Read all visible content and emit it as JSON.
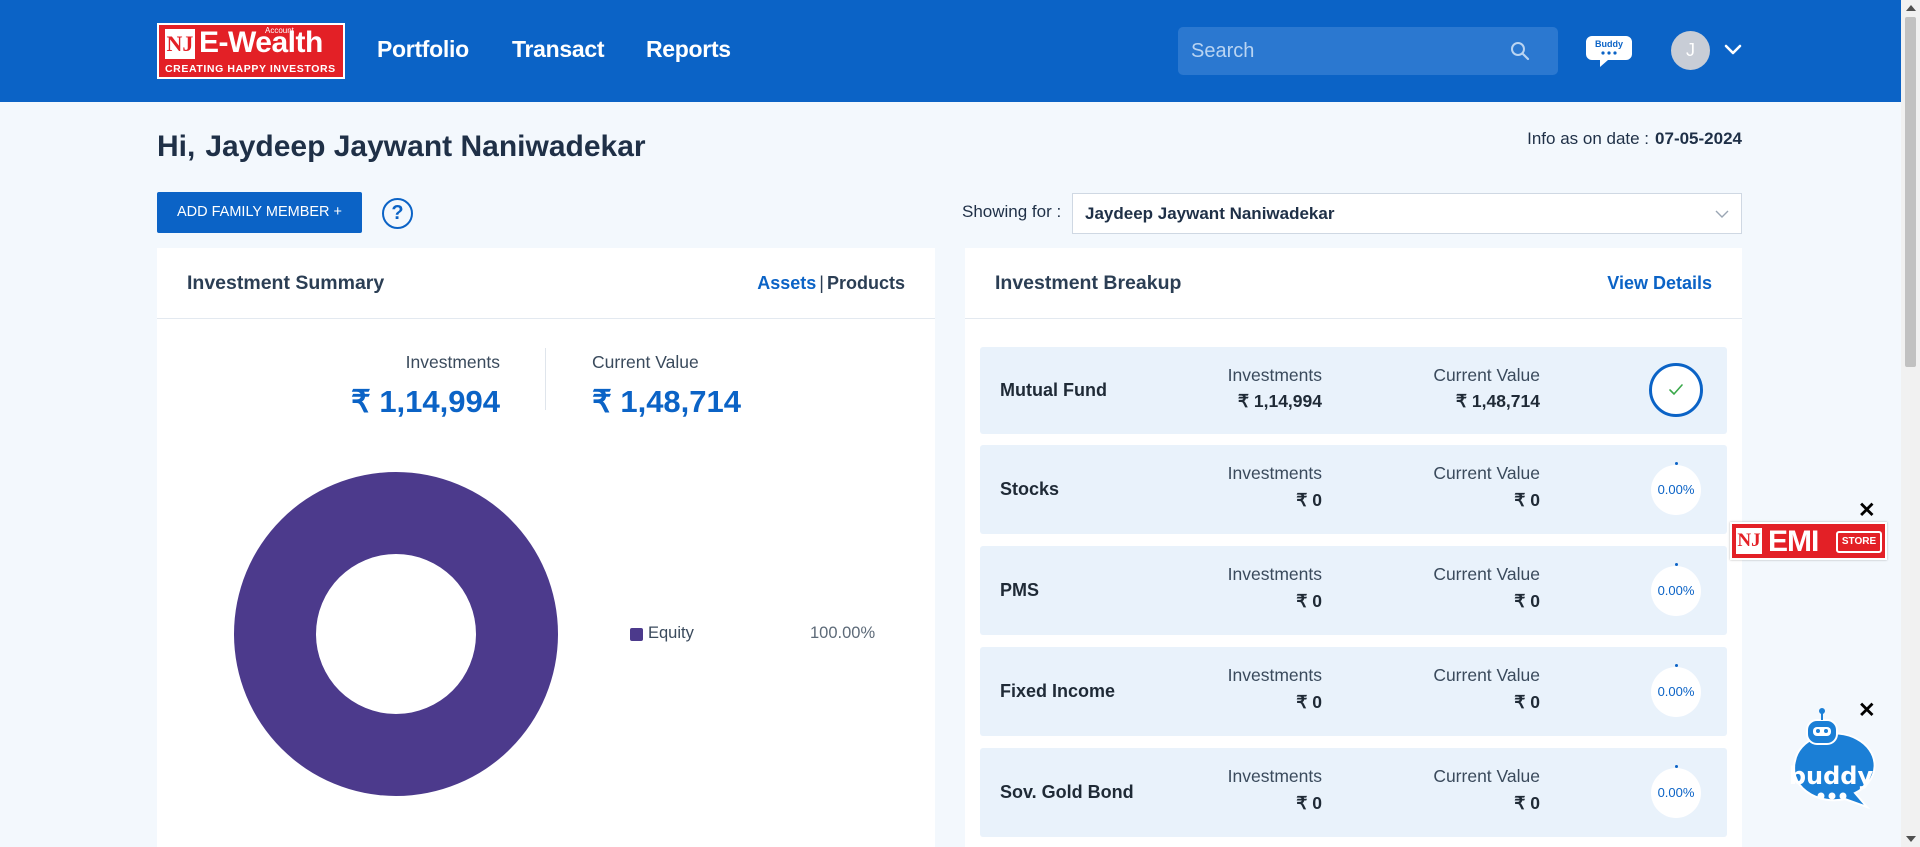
{
  "header": {
    "logo": {
      "monogram": "NJ",
      "brand": "E-Wealth",
      "superscript": "Account",
      "tagline": "CREATING HAPPY INVESTORS"
    },
    "nav": [
      "Portfolio",
      "Transact",
      "Reports"
    ],
    "search": {
      "placeholder": "Search",
      "value": ""
    },
    "buddy_label": "Buddy",
    "avatar_initial": "J"
  },
  "greeting": {
    "hi": "Hi,",
    "name": "Jaydeep Jaywant Naniwadekar"
  },
  "info": {
    "label": "Info as on date :",
    "date": "07-05-2024"
  },
  "add_member_label": "ADD FAMILY MEMBER +",
  "help_label": "?",
  "showing": {
    "label": "Showing for :",
    "selected": "Jaydeep Jaywant Naniwadekar"
  },
  "summary": {
    "title": "Investment Summary",
    "tabs": {
      "assets": "Assets",
      "separator": "|",
      "products": "Products",
      "active": "assets"
    },
    "investments_label": "Investments",
    "investments_value": "₹ 1,14,994",
    "current_label": "Current Value",
    "current_value": "₹ 1,48,714",
    "chart": {
      "type": "pie",
      "donut": true,
      "slices": [
        {
          "name": "Equity",
          "percent": 100.0,
          "percent_label": "100.00%",
          "color": "#4c3a8c"
        }
      ]
    }
  },
  "breakup": {
    "title": "Investment Breakup",
    "view_details": "View Details",
    "investments_label": "Investments",
    "current_label": "Current Value",
    "rows": [
      {
        "name": "Mutual Fund",
        "investments": "₹ 1,14,994",
        "current": "₹ 1,48,714",
        "status": "selected"
      },
      {
        "name": "Stocks",
        "investments": "₹ 0",
        "current": "₹ 0",
        "percent": "0.00%"
      },
      {
        "name": "PMS",
        "investments": "₹ 0",
        "current": "₹ 0",
        "percent": "0.00%"
      },
      {
        "name": "Fixed Income",
        "investments": "₹ 0",
        "current": "₹ 0",
        "percent": "0.00%"
      },
      {
        "name": "Sov. Gold Bond",
        "investments": "₹ 0",
        "current": "₹ 0",
        "percent": "0.00%"
      }
    ]
  },
  "emi_store": {
    "monogram": "NJ",
    "text": "EMI",
    "badge": "STORE",
    "close": "✕"
  },
  "buddy_bot": {
    "label": "buddy",
    "close": "✕"
  },
  "colors": {
    "primary": "#0b63c6",
    "brand_red": "#e32026",
    "equity": "#4c3a8c",
    "row_bg": "#e9f2fb"
  }
}
